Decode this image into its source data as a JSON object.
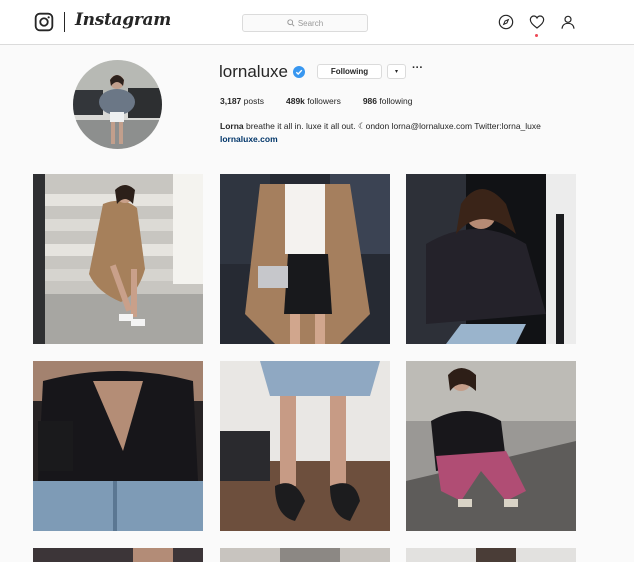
{
  "nav": {
    "logo_text": "Instagram",
    "search_placeholder": "Search",
    "icons": [
      "instagram-camera-icon",
      "search-icon",
      "compass-icon",
      "heart-icon",
      "person-icon"
    ],
    "notification_dot_color": "#ed4956"
  },
  "profile": {
    "username": "lornaluxe",
    "verified": true,
    "follow_button": "Following",
    "dropdown_glyph": "▾",
    "more_glyph": "···",
    "stats": {
      "posts_count": "3,187",
      "posts_label": "posts",
      "followers_count": "489k",
      "followers_label": "followers",
      "following_count": "986",
      "following_label": "following"
    },
    "bio": {
      "name": "Lorna",
      "text": "breathe it all in. luxe it all out. ☾ondon lorna@lornaluxe.com Twitter:lorna_luxe",
      "link": "lornaluxe.com"
    }
  },
  "colors": {
    "accent_blue": "#3897f0",
    "link": "#003569",
    "border": "#dbdbdb",
    "background": "#fafafa"
  },
  "posts": [
    {
      "id": "post-1",
      "alt_icon": "photo-stairs-trench"
    },
    {
      "id": "post-2",
      "alt_icon": "photo-trench-skirt"
    },
    {
      "id": "post-3",
      "alt_icon": "photo-car-lace"
    },
    {
      "id": "post-4",
      "alt_icon": "photo-lace-top-bag"
    },
    {
      "id": "post-5",
      "alt_icon": "photo-heels"
    },
    {
      "id": "post-6",
      "alt_icon": "photo-pink-pants"
    },
    {
      "id": "post-7",
      "alt_icon": "photo-partial"
    },
    {
      "id": "post-8",
      "alt_icon": "photo-partial"
    },
    {
      "id": "post-9",
      "alt_icon": "photo-partial"
    }
  ]
}
